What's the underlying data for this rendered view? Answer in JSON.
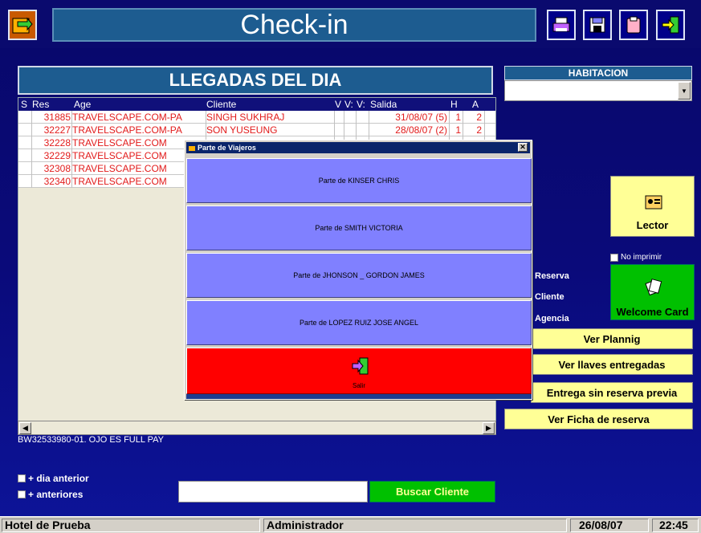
{
  "window": {
    "title": "Check-in"
  },
  "toolbar": {
    "left_icon": "exit-arrow-icon",
    "right_icons": [
      "printer-icon",
      "save-disk-icon",
      "clipboard-icon",
      "exit-door-icon"
    ]
  },
  "arrivals": {
    "title": "LLEGADAS DEL DIA",
    "columns": [
      "S",
      "Res",
      "Age",
      "Cliente",
      "V",
      "V:",
      "V:",
      "Salida",
      "H",
      "A"
    ],
    "rows": [
      {
        "res": "31885",
        "age": "TRAVELSCAPE.COM-PA",
        "cliente": "SINGH  SUKHRAJ",
        "salida": "31/08/07 (5)",
        "h": "1",
        "a": "2"
      },
      {
        "res": "32227",
        "age": "TRAVELSCAPE.COM-PA",
        "cliente": "SON  YUSEUNG",
        "salida": "28/08/07 (2)",
        "h": "1",
        "a": "2"
      },
      {
        "res": "32228",
        "age": "TRAVELSCAPE.COM",
        "cliente": "",
        "salida": "",
        "h": "",
        "a": ""
      },
      {
        "res": "32229",
        "age": "TRAVELSCAPE.COM",
        "cliente": "",
        "salida": "",
        "h": "",
        "a": ""
      },
      {
        "res": "32308",
        "age": "TRAVELSCAPE.COM",
        "cliente": "",
        "salida": "",
        "h": "",
        "a": ""
      },
      {
        "res": "32340",
        "age": "TRAVELSCAPE.COM",
        "cliente": "",
        "salida": "",
        "h": "",
        "a": ""
      }
    ],
    "note": "BW32533980-01. OJO ES FULL PAY"
  },
  "room": {
    "title": "HABITACION",
    "selected": ""
  },
  "lector": {
    "label": "Lector"
  },
  "no_imprimir": {
    "label": "No imprimir"
  },
  "welcome_card": {
    "label": "Welcome Card"
  },
  "info_labels": {
    "reserva": "Reserva",
    "cliente": "Cliente",
    "agencia": "Agencia"
  },
  "actions": {
    "ver_planning": "Ver Plannig",
    "ver_llaves": "Ver llaves entregadas",
    "entrega_sin_reserva": "Entrega sin reserva previa",
    "ver_ficha": "Ver Ficha de reserva"
  },
  "filters": {
    "dia_anterior": "+ dia anterior",
    "anteriores": "+ anteriores"
  },
  "search": {
    "value": "",
    "button": "Buscar Cliente"
  },
  "status_bar": {
    "hotel": "Hotel de Prueba",
    "user": "Administrador",
    "date": "26/08/07",
    "time": "22:45"
  },
  "dialog": {
    "title": "Parte de Viajeros",
    "buttons": [
      "Parte de KINSER  CHRIS",
      "Parte de SMITH  VICTORIA",
      "Parte de JHONSON _ GORDON JAMES",
      "Parte de LOPEZ RUIZ JOSE ANGEL"
    ],
    "exit_label": "Salir"
  }
}
